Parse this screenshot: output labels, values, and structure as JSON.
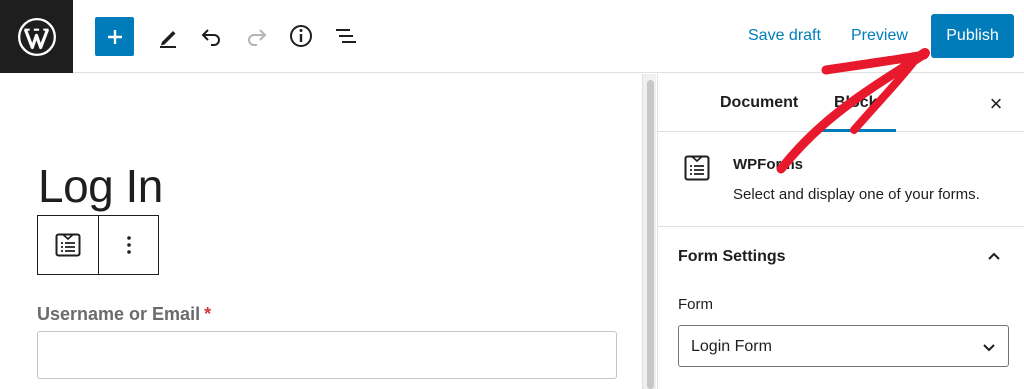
{
  "toolbar": {
    "save_draft": "Save draft",
    "preview": "Preview",
    "publish": "Publish",
    "icons": [
      "wordpress-logo-icon",
      "plus-icon",
      "pencil-icon",
      "undo-icon",
      "redo-icon",
      "info-icon",
      "list-view-icon"
    ]
  },
  "editor": {
    "title": "Log In",
    "field_label": "Username or Email",
    "required_mark": "*",
    "field_value": ""
  },
  "sidebar": {
    "tabs": [
      {
        "label": "Document",
        "active": false
      },
      {
        "label": "Block",
        "active": true
      }
    ],
    "close": "×",
    "block": {
      "name": "WPForms",
      "description": "Select and display one of your forms."
    },
    "settings": {
      "title": "Form Settings",
      "form_label": "Form",
      "form_selected": "Login Form"
    }
  },
  "colors": {
    "accent": "#007cba",
    "annotation_arrow": "#e8192c",
    "logo_bg": "#1e1e1e"
  }
}
